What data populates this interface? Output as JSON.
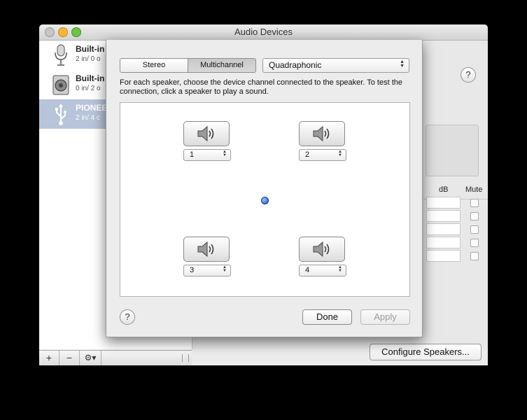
{
  "window": {
    "title": "Audio Devices"
  },
  "devices": [
    {
      "name": "Built-in",
      "sub": "2 in/ 0 o",
      "icon": "microphone-icon"
    },
    {
      "name": "Built-in",
      "sub": "0 in/ 2 o",
      "icon": "speaker-icon"
    },
    {
      "name": "PIONEE",
      "sub": "2 in/ 4 c",
      "icon": "usb-icon",
      "selected": true
    }
  ],
  "sidebar_footer": {
    "add": "+",
    "remove": "−",
    "gear": "⚙▾"
  },
  "right_pane": {
    "columns": {
      "db": "dB",
      "mute": "Mute"
    },
    "help": "?",
    "configure_button": "Configure Speakers..."
  },
  "sheet": {
    "segments": {
      "stereo": "Stereo",
      "multichannel": "Multichannel"
    },
    "selected_segment": "Multichannel",
    "mode": "Quadraphonic",
    "instruction": "For each speaker, choose the device channel connected to the speaker. To test the connection, click a speaker to play a sound.",
    "speakers": [
      {
        "channel": "1"
      },
      {
        "channel": "2"
      },
      {
        "channel": "3"
      },
      {
        "channel": "4"
      }
    ],
    "help": "?",
    "done": "Done",
    "apply": "Apply"
  },
  "colors": {
    "selection": "#b7c4d9",
    "listener": "#1d4fb8"
  }
}
